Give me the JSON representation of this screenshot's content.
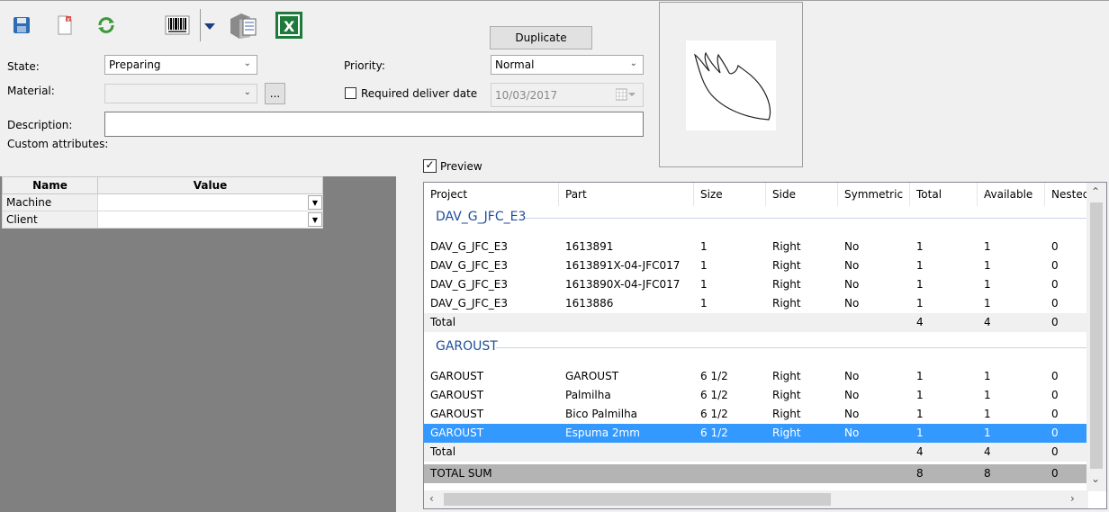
{
  "toolbar": {
    "icons": [
      "save-icon",
      "new-document-icon",
      "refresh-icon",
      "barcode-icon",
      "dropdown-arrow-icon",
      "document-package-icon",
      "excel-icon"
    ],
    "excel_glyph": "X"
  },
  "form": {
    "state_label": "State:",
    "state_value": "Preparing",
    "material_label": "Material:",
    "material_value": "",
    "ellipsis_label": "...",
    "description_label": "Description:",
    "description_value": "",
    "custom_attributes_label": "Custom attributes:",
    "priority_label": "Priority:",
    "priority_value": "Normal",
    "duplicate_label": "Duplicate",
    "required_deliver_label": "Required deliver date",
    "required_deliver_checked": false,
    "deliver_date_value": "10/03/2017"
  },
  "attributes": {
    "headers": [
      "Name",
      "Value"
    ],
    "rows": [
      {
        "name": "Machine",
        "value": ""
      },
      {
        "name": "Client",
        "value": ""
      }
    ]
  },
  "preview": {
    "label": "Preview",
    "checked": true,
    "check_glyph": "✓"
  },
  "grid": {
    "columns": [
      "Project",
      "Part",
      "Size",
      "Side",
      "Symmetric",
      "Total",
      "Available",
      "Nested"
    ],
    "groups": [
      {
        "title": "DAV_G_JFC_E3",
        "rows": [
          [
            "DAV_G_JFC_E3",
            "1613891",
            "1",
            "Right",
            "No",
            "1",
            "1",
            "0"
          ],
          [
            "DAV_G_JFC_E3",
            "1613891X-04-JFC017",
            "1",
            "Right",
            "No",
            "1",
            "1",
            "0"
          ],
          [
            "DAV_G_JFC_E3",
            "1613890X-04-JFC017",
            "1",
            "Right",
            "No",
            "1",
            "1",
            "0"
          ],
          [
            "DAV_G_JFC_E3",
            "1613886",
            "1",
            "Right",
            "No",
            "1",
            "1",
            "0"
          ]
        ],
        "total": [
          "Total",
          "",
          "",
          "",
          "",
          "4",
          "4",
          "0"
        ]
      },
      {
        "title": "GAROUST",
        "rows": [
          [
            "GAROUST",
            "GAROUST",
            "6 1/2",
            "Right",
            "No",
            "1",
            "1",
            "0"
          ],
          [
            "GAROUST",
            "Palmilha",
            "6 1/2",
            "Right",
            "No",
            "1",
            "1",
            "0"
          ],
          [
            "GAROUST",
            "Bico Palmilha",
            "6 1/2",
            "Right",
            "No",
            "1",
            "1",
            "0"
          ],
          [
            "GAROUST",
            "Espuma 2mm",
            "6 1/2",
            "Right",
            "No",
            "1",
            "1",
            "0"
          ]
        ],
        "total": [
          "Total",
          "",
          "",
          "",
          "",
          "4",
          "4",
          "0"
        ]
      }
    ],
    "total_sum": [
      "TOTAL SUM",
      "",
      "",
      "",
      "",
      "8",
      "8",
      "0"
    ],
    "selected": {
      "group": 1,
      "row": 3
    }
  },
  "colors": {
    "selection": "#3399ff",
    "group_title": "#1e4e9a",
    "attr_panel": "#808080",
    "excel_green": "#1d7a3a"
  }
}
